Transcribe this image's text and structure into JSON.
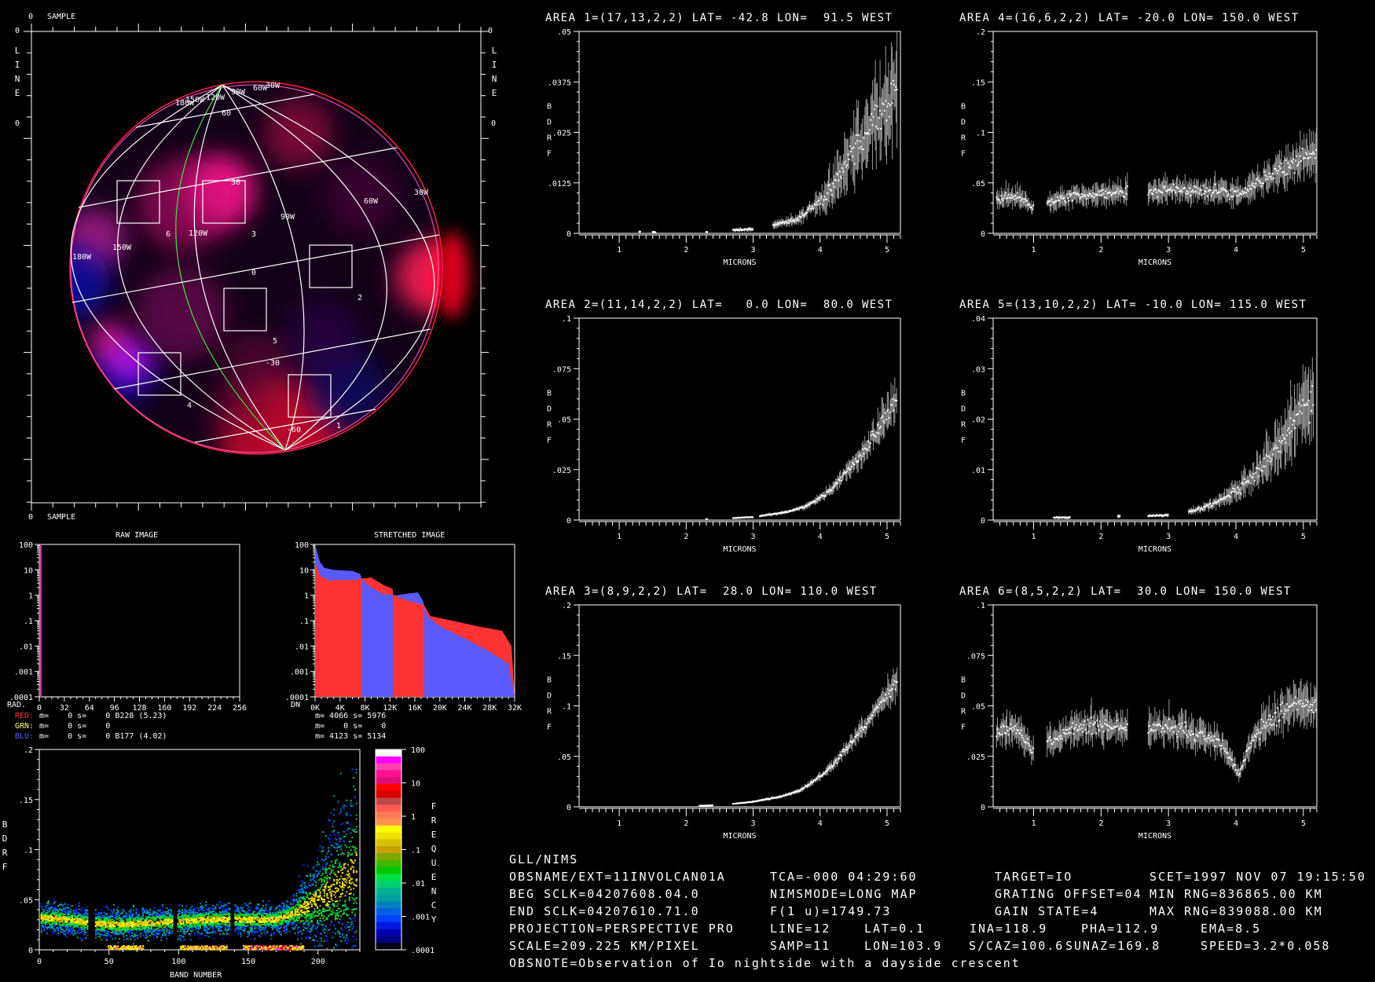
{
  "colors": {
    "background": "#000000",
    "axis": "#ffffff",
    "red": "#ff3333",
    "green": "#ffff80",
    "blue": "#5a5aff",
    "raw_line": "#c040a0",
    "terminator": "#40e040",
    "limb_red": "#ff2040",
    "limb_pink": "#ff60c0"
  },
  "map": {
    "top_zero": "0",
    "top_label": "SAMPLE",
    "bottom_zero": "0",
    "bottom_label": "SAMPLE",
    "left_zero": "0",
    "right_zero": "0",
    "left_zero2": "0",
    "right_zero2": "0",
    "left_axis": "LINE",
    "right_axis": "LINE",
    "longitude_labels": [
      "180W",
      "150W",
      "120W",
      "90W",
      "60W",
      "30W"
    ],
    "top_longitude_labels": [
      "180W",
      "150W",
      "120W",
      "90W",
      "60W",
      "30W"
    ],
    "latitude_labels": [
      "60",
      "30",
      "0",
      "-30",
      "-60"
    ],
    "area_labels": [
      "1",
      "2",
      "3",
      "4",
      "5",
      "6"
    ]
  },
  "raw_hist": {
    "title": "RAW IMAGE",
    "x_label": "RAD.",
    "x_ticks": [
      "0",
      "32",
      "64",
      "96",
      "128",
      "160",
      "192",
      "224",
      "256"
    ],
    "y_ticks": [
      "100",
      "10",
      "1",
      ".1",
      ".01",
      ".001",
      ".0001"
    ],
    "xlim": [
      0,
      256
    ],
    "ylim": [
      0.0001,
      100
    ]
  },
  "stretched_hist": {
    "title": "STRETCHED IMAGE",
    "x_label": "DN",
    "x_ticks": [
      "0K",
      "4K",
      "8K",
      "12K",
      "16K",
      "20K",
      "24K",
      "28K",
      "32K"
    ],
    "y_ticks": [
      "100",
      "10",
      "1",
      ".1",
      ".01",
      ".001",
      ".0001"
    ],
    "xlim": [
      0,
      32000
    ],
    "ylim": [
      0.0001,
      100
    ],
    "red_bands": [
      [
        0,
        7500
      ],
      [
        12500,
        17500
      ]
    ],
    "blue_bands": [
      [
        7500,
        12500
      ],
      [
        17500,
        32000
      ]
    ],
    "blue_envelope": [
      [
        0,
        100
      ],
      [
        800,
        20
      ],
      [
        1500,
        12
      ],
      [
        3000,
        10
      ],
      [
        6000,
        9
      ],
      [
        7200,
        7
      ],
      [
        7600,
        4
      ],
      [
        9000,
        2
      ],
      [
        11000,
        1.1
      ],
      [
        13000,
        1
      ],
      [
        16500,
        1.3
      ],
      [
        17300,
        0.6
      ],
      [
        18000,
        0.15
      ],
      [
        20000,
        0.06
      ],
      [
        24000,
        0.02
      ],
      [
        28000,
        0.006
      ],
      [
        31000,
        0.002
      ],
      [
        32000,
        0.0001
      ]
    ],
    "red_envelope": [
      [
        0,
        20
      ],
      [
        800,
        6
      ],
      [
        2000,
        4
      ],
      [
        6000,
        4
      ],
      [
        7500,
        4.5
      ],
      [
        9000,
        5
      ],
      [
        11000,
        2.5
      ],
      [
        12400,
        1.8
      ],
      [
        12600,
        1
      ],
      [
        15000,
        0.6
      ],
      [
        17500,
        0.4
      ],
      [
        18500,
        0.15
      ],
      [
        22000,
        0.1
      ],
      [
        26000,
        0.06
      ],
      [
        30000,
        0.04
      ],
      [
        31500,
        0.01
      ],
      [
        32000,
        0.0001
      ]
    ]
  },
  "stats": {
    "raw": [
      {
        "channel": "RED:",
        "text": "m=    0 s=    0 B228 (5.23)"
      },
      {
        "channel": "GRN:",
        "text": "m=    0 s=    0"
      },
      {
        "channel": "BLU:",
        "text": "m=    0 s=    0 B177 (4.02)"
      }
    ],
    "stretched": [
      "m= 4066 s= 5976",
      "m=    0 s=    0",
      "m= 4123 s= 5134"
    ]
  },
  "density": {
    "xlabel": "BAND NUMBER",
    "ylabel": "BDRF",
    "x_ticks": [
      "0",
      "50",
      "100",
      "150",
      "200"
    ],
    "y_ticks": [
      "0",
      ".05",
      ".1",
      ".15",
      ".2"
    ],
    "xlim": [
      0,
      230
    ],
    "ylim": [
      0,
      0.2
    ],
    "band_mean": [
      [
        0,
        0.032
      ],
      [
        20,
        0.03
      ],
      [
        40,
        0.026
      ],
      [
        60,
        0.025
      ],
      [
        80,
        0.027
      ],
      [
        100,
        0.028
      ],
      [
        120,
        0.03
      ],
      [
        150,
        0.03
      ],
      [
        170,
        0.03
      ],
      [
        185,
        0.038
      ],
      [
        200,
        0.05
      ],
      [
        215,
        0.065
      ],
      [
        228,
        0.08
      ]
    ]
  },
  "colorbar": {
    "label": "FREQUENCY",
    "ticks": [
      "100",
      "10",
      "1",
      ".1",
      ".01",
      ".001",
      ".0001"
    ],
    "colors": [
      "#ffffff",
      "#ff00ff",
      "#ff40b0",
      "#ff1090",
      "#e0107a",
      "#ff0000",
      "#d80000",
      "#c04848",
      "#ff5a50",
      "#ff7a58",
      "#ff9050",
      "#ffff00",
      "#f0e000",
      "#d8c000",
      "#c8a000",
      "#80a800",
      "#40b800",
      "#00c800",
      "#00e040",
      "#00d070",
      "#00b090",
      "#00a0a0",
      "#0080c0",
      "#0060e0",
      "#0040ff",
      "#0018e0",
      "#0000b0",
      "#000080",
      "#000010"
    ]
  },
  "chart_data": [
    {
      "type": "line",
      "title": "AREA 1=(17,13,2,2) LAT= -42.8 LON=  91.5 WEST",
      "xlabel": "MICRONS",
      "ylabel": "BDRF",
      "xlim": [
        0.4,
        5.2
      ],
      "ylim": [
        0,
        0.05
      ],
      "yticks": [
        0,
        0.0125,
        0.025,
        0.0375,
        0.05
      ],
      "ytick_labels": [
        "0",
        ".0125",
        ".025",
        ".0375",
        ".05"
      ],
      "xticks": [
        1,
        2,
        3,
        4,
        5
      ],
      "err": 0.35,
      "segments": [
        [
          [
            1.3,
            0.0004
          ],
          [
            1.32,
            0.0004
          ]
        ],
        [
          [
            1.5,
            0.0003
          ],
          [
            1.55,
            0.0003
          ]
        ],
        [
          [
            2.3,
            0.0003
          ],
          [
            2.32,
            0.0003
          ]
        ],
        [
          [
            2.7,
            0.0008
          ],
          [
            3.0,
            0.001
          ]
        ],
        [
          [
            3.3,
            0.002
          ],
          [
            3.6,
            0.003
          ],
          [
            3.8,
            0.005
          ],
          [
            4.0,
            0.008
          ],
          [
            4.2,
            0.012
          ],
          [
            4.4,
            0.017
          ],
          [
            4.6,
            0.023
          ],
          [
            4.8,
            0.027
          ],
          [
            5.0,
            0.03
          ],
          [
            5.15,
            0.038
          ]
        ]
      ]
    },
    {
      "type": "line",
      "title": "AREA 2=(11,14,2,2) LAT=   0.0 LON=  80.0 WEST",
      "xlabel": "MICRONS",
      "ylabel": "BDRF",
      "xlim": [
        0.4,
        5.2
      ],
      "ylim": [
        0,
        0.1
      ],
      "yticks": [
        0,
        0.025,
        0.05,
        0.075,
        0.1
      ],
      "ytick_labels": [
        "0",
        ".025",
        ".05",
        ".075",
        ".1"
      ],
      "xticks": [
        1,
        2,
        3,
        4,
        5
      ],
      "err": 0.15,
      "segments": [
        [
          [
            2.3,
            0.0005
          ],
          [
            2.32,
            0.0005
          ]
        ],
        [
          [
            2.7,
            0.001
          ],
          [
            3.0,
            0.0015
          ]
        ],
        [
          [
            3.1,
            0.002
          ],
          [
            3.5,
            0.004
          ],
          [
            3.8,
            0.007
          ],
          [
            4.0,
            0.011
          ],
          [
            4.2,
            0.016
          ],
          [
            4.4,
            0.024
          ],
          [
            4.6,
            0.031
          ],
          [
            4.8,
            0.042
          ],
          [
            5.0,
            0.052
          ],
          [
            5.15,
            0.06
          ]
        ]
      ]
    },
    {
      "type": "line",
      "title": "AREA 3=(8,9,2,2) LAT=  28.0 LON= 110.0 WEST",
      "xlabel": "MICRONS",
      "ylabel": "BDRF",
      "xlim": [
        0.4,
        5.2
      ],
      "ylim": [
        0,
        0.2
      ],
      "yticks": [
        0,
        0.05,
        0.1,
        0.15,
        0.2
      ],
      "ytick_labels": [
        "0",
        ".05",
        ".1",
        ".15",
        ".2"
      ],
      "xticks": [
        1,
        2,
        3,
        4,
        5
      ],
      "err": 0.1,
      "segments": [
        [
          [
            2.2,
            0.001
          ],
          [
            2.4,
            0.0015
          ]
        ],
        [
          [
            2.7,
            0.003
          ],
          [
            3.0,
            0.005
          ],
          [
            3.4,
            0.01
          ],
          [
            3.7,
            0.016
          ],
          [
            4.0,
            0.03
          ],
          [
            4.2,
            0.042
          ],
          [
            4.4,
            0.058
          ],
          [
            4.6,
            0.075
          ],
          [
            4.8,
            0.093
          ],
          [
            5.0,
            0.11
          ],
          [
            5.15,
            0.125
          ]
        ]
      ]
    },
    {
      "type": "line",
      "title": "AREA 4=(16,6,2,2) LAT= -20.0 LON= 150.0 WEST",
      "xlabel": "MICRONS",
      "ylabel": "BDRF",
      "xlim": [
        0.4,
        5.2
      ],
      "ylim": [
        0,
        0.2
      ],
      "yticks": [
        0,
        0.05,
        0.1,
        0.15,
        0.2
      ],
      "ytick_labels": [
        "0",
        ".05",
        ".1",
        ".15",
        ".2"
      ],
      "xticks": [
        1,
        2,
        3,
        4,
        5
      ],
      "err": 0.25,
      "segments": [
        [
          [
            0.45,
            0.033
          ],
          [
            0.6,
            0.037
          ],
          [
            0.75,
            0.038
          ],
          [
            0.9,
            0.03
          ],
          [
            1.0,
            0.025
          ]
        ],
        [
          [
            1.2,
            0.03
          ],
          [
            1.5,
            0.036
          ],
          [
            1.8,
            0.038
          ],
          [
            2.1,
            0.04
          ],
          [
            2.4,
            0.04
          ]
        ],
        [
          [
            2.7,
            0.04
          ],
          [
            3.0,
            0.045
          ],
          [
            3.3,
            0.042
          ],
          [
            3.6,
            0.043
          ],
          [
            3.9,
            0.04
          ],
          [
            4.1,
            0.04
          ],
          [
            4.3,
            0.05
          ],
          [
            4.6,
            0.06
          ],
          [
            4.8,
            0.068
          ],
          [
            5.0,
            0.075
          ],
          [
            5.2,
            0.08
          ]
        ]
      ]
    },
    {
      "type": "line",
      "title": "AREA 5=(13,10,2,2) LAT= -10.0 LON= 115.0 WEST",
      "xlabel": "MICRONS",
      "ylabel": "BDRF",
      "xlim": [
        0.4,
        5.2
      ],
      "ylim": [
        0,
        0.04
      ],
      "yticks": [
        0,
        0.01,
        0.02,
        0.03,
        0.04
      ],
      "ytick_labels": [
        "0",
        ".01",
        ".02",
        ".03",
        ".04"
      ],
      "xticks": [
        1,
        2,
        3,
        4,
        5
      ],
      "err": 0.3,
      "segments": [
        [
          [
            1.3,
            0.0005
          ],
          [
            1.55,
            0.0005
          ]
        ],
        [
          [
            2.25,
            0.0008
          ],
          [
            2.28,
            0.0008
          ]
        ],
        [
          [
            2.7,
            0.0008
          ],
          [
            3.0,
            0.001
          ]
        ],
        [
          [
            3.3,
            0.0015
          ],
          [
            3.6,
            0.003
          ],
          [
            3.8,
            0.004
          ],
          [
            4.0,
            0.006
          ],
          [
            4.2,
            0.008
          ],
          [
            4.4,
            0.011
          ],
          [
            4.6,
            0.014
          ],
          [
            4.8,
            0.018
          ],
          [
            5.0,
            0.022
          ],
          [
            5.15,
            0.025
          ]
        ]
      ]
    },
    {
      "type": "line",
      "title": "AREA 6=(8,5,2,2) LAT=  30.0 LON= 150.0 WEST",
      "xlabel": "MICRONS",
      "ylabel": "BDRF",
      "xlim": [
        0.4,
        5.2
      ],
      "ylim": [
        0,
        0.1
      ],
      "yticks": [
        0,
        0.025,
        0.05,
        0.075,
        0.1
      ],
      "ytick_labels": [
        "0",
        ".025",
        ".05",
        ".075",
        ".1"
      ],
      "xticks": [
        1,
        2,
        3,
        4,
        5
      ],
      "err": 0.18,
      "segments": [
        [
          [
            0.45,
            0.036
          ],
          [
            0.6,
            0.04
          ],
          [
            0.75,
            0.037
          ],
          [
            0.9,
            0.032
          ],
          [
            1.0,
            0.028
          ]
        ],
        [
          [
            1.2,
            0.032
          ],
          [
            1.5,
            0.037
          ],
          [
            1.8,
            0.04
          ],
          [
            2.1,
            0.04
          ],
          [
            2.4,
            0.038
          ]
        ],
        [
          [
            2.7,
            0.04
          ],
          [
            3.0,
            0.04
          ],
          [
            3.3,
            0.037
          ],
          [
            3.6,
            0.035
          ],
          [
            3.8,
            0.03
          ],
          [
            3.95,
            0.022
          ],
          [
            4.05,
            0.016
          ],
          [
            4.2,
            0.03
          ],
          [
            4.4,
            0.04
          ],
          [
            4.6,
            0.045
          ],
          [
            4.8,
            0.05
          ],
          [
            5.0,
            0.052
          ],
          [
            5.2,
            0.048
          ]
        ]
      ]
    }
  ],
  "info": {
    "header": "GLL/NIMS",
    "obsname": "OBSNAME/EXT=11INVOLCAN01A",
    "tca": "TCA=-000 04:29:60",
    "target": "TARGET=IO",
    "scet": "SCET=1997 NOV 07 19:15:50",
    "beg_sclk": "BEG SCLK=04207608.04.0",
    "nimsmode": "NIMSMODE=LONG MAP",
    "grating": "GRATING OFFSET=04",
    "min_rng": "MIN RNG=836865.00 KM",
    "end_sclk": "END SCLK=04207610.71.0",
    "f1u": "F(1 u)=1749.73",
    "gain": "GAIN STATE=4",
    "max_rng": "MAX RNG=839088.00 KM",
    "projection": "PROJECTION=PERSPECTIVE PRO",
    "line": "LINE=12",
    "lat": "LAT=0.1",
    "ina": "INA=118.9",
    "pha": "PHA=112.9",
    "ema": "EMA=8.5",
    "scale": "SCALE=209.225 KM/PIXEL",
    "samp": "SAMP=11",
    "lon": "LON=103.9",
    "scaz": "S/CAZ=100.6",
    "sunaz": "SUNAZ=169.8",
    "speed": "SPEED=3.2*0.058",
    "obsnote": "OBSNOTE=Observation of Io nightside with a dayside crescent"
  }
}
